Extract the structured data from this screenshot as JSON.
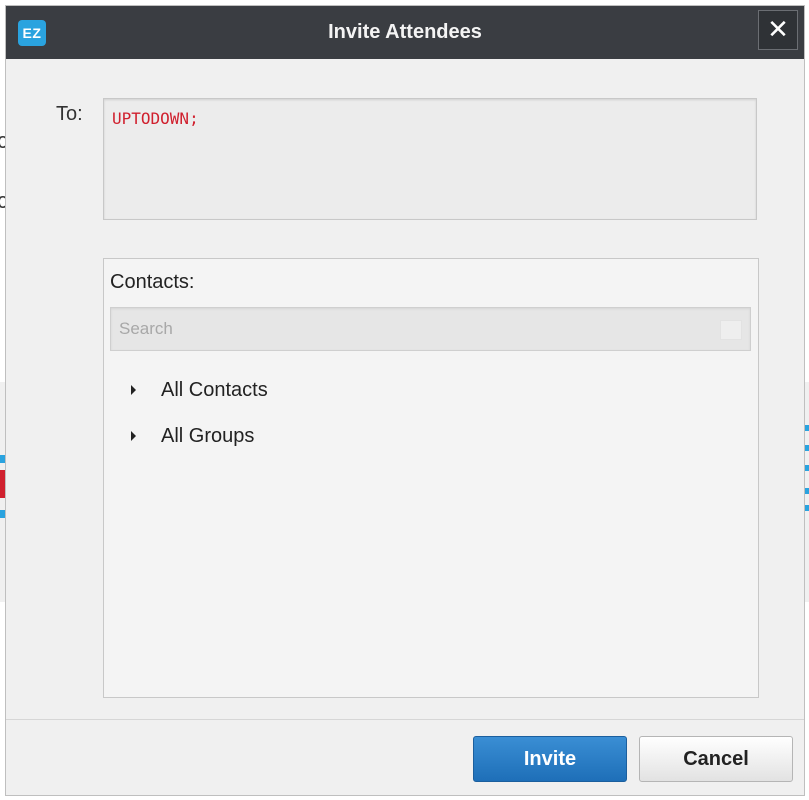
{
  "window": {
    "title": "Invite Attendees",
    "logo_text": "EZ",
    "close_symbol": "✕",
    "close_icon": "close-icon"
  },
  "to_field": {
    "label": "To:",
    "value": "UPTODOWN;",
    "value_color": "#d0202e"
  },
  "contacts": {
    "label": "Contacts:",
    "search": {
      "placeholder": "Search",
      "value": ""
    },
    "tree": [
      {
        "label": "All Contacts",
        "icon": "expand-arrow-icon"
      },
      {
        "label": "All Groups",
        "icon": "expand-arrow-icon"
      }
    ]
  },
  "footer": {
    "invite_label": "Invite",
    "cancel_label": "Cancel"
  },
  "colors": {
    "titlebar": "#3a3d42",
    "logo": "#2aa3df",
    "primary_button": "#1e6fb8",
    "dialog_background": "#f0f0f0"
  }
}
